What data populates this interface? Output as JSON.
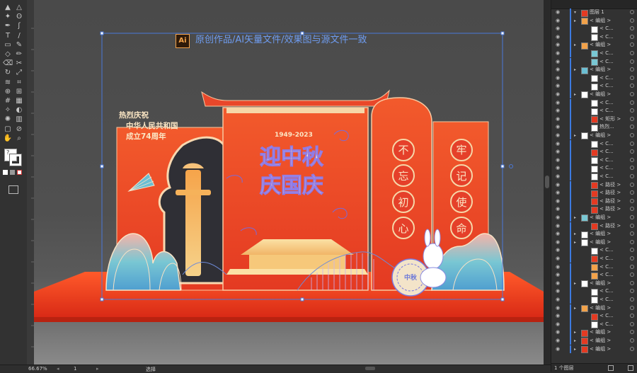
{
  "toolbar": {
    "tools": [
      "selection-tool",
      "direct-selection-tool",
      "magic-wand-tool",
      "lasso-tool",
      "pen-tool",
      "curvature-tool",
      "type-tool",
      "line-tool",
      "rectangle-tool",
      "paintbrush-tool",
      "shaper-tool",
      "pencil-tool",
      "eraser-tool",
      "scissors-tool",
      "rotate-tool",
      "scale-tool",
      "width-tool",
      "free-transform-tool",
      "shape-builder-tool",
      "perspective-tool",
      "mesh-tool",
      "gradient-tool",
      "eyedropper-tool",
      "blend-tool",
      "symbol-sprayer-tool",
      "column-graph-tool",
      "artboard-tool",
      "slice-tool",
      "hand-tool",
      "zoom-tool"
    ],
    "help_label": "?"
  },
  "artwork": {
    "banner_logo": "Ai",
    "banner_text": "原创作品/AI矢量文件/效果图与源文件一致",
    "left_lines": [
      "热烈庆祝",
      "中华人民共和国",
      "成立74周年"
    ],
    "year_text": "1949-2023",
    "title_line1": "迎中秋",
    "title_line2": "庆国庆",
    "medallion_left": [
      "不",
      "忘",
      "初",
      "心"
    ],
    "medallion_right": [
      "牢",
      "记",
      "使",
      "命"
    ],
    "mooncake_text": "中秋"
  },
  "status": {
    "zoom": "66.67%",
    "page": "1",
    "mode": "选择"
  },
  "layers_panel": {
    "top_layer": "图层 1",
    "rows": [
      "< 编组 >",
      "< C...",
      "< C...",
      "< 编组 >",
      "< C...",
      "< C...",
      "< 编组 >",
      "< C...",
      "< C...",
      "< 编组 >",
      "< C...",
      "< C...",
      "< 矩形 >",
      "热烈...",
      "< 编组 >",
      "< C...",
      "< C...",
      "< C...",
      "< C...",
      "< C...",
      "< 路径 >",
      "< 路径 >",
      "< 路径 >",
      "< 路径 >",
      "< 编组 >",
      "< 路径 >",
      "< 编组 >",
      "< 编组 >",
      "< C...",
      "< C...",
      "< C...",
      "< C...",
      "< 编组 >",
      "< C...",
      "< C...",
      "< 编组 >",
      "< C...",
      "< C...",
      "< 编组 >",
      "< 编组 >",
      "< 编组 >"
    ],
    "footer_count": "1 个图层"
  },
  "colors": {
    "accent_red": "#e8452a",
    "orange": "#f07a2a",
    "gold": "#f6c87a",
    "teal": "#5ab5c6",
    "pink": "#f4a29a",
    "selection_blue": "#4a78d9"
  }
}
